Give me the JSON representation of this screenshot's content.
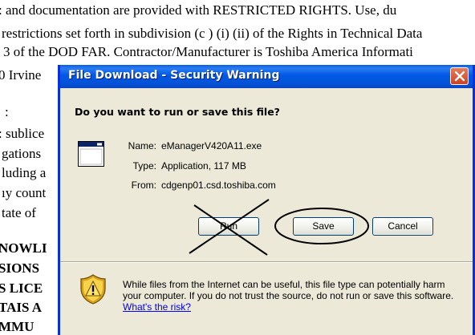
{
  "background_document": {
    "lines": [
      ": and documentation are provided with RESTRICTED RIGHTS. Use, du",
      "restrictions set forth in subdivision (c ) (i) (ii) of the Rights in Technical Data",
      "3 of the DOD FAR. Contractor/Manufacturer is Toshiba America Informati",
      "0 Irvine",
      ":",
      ": sublice",
      "gations",
      "luding a",
      "ıy count",
      "tate of",
      "NOWLI",
      "SIONS",
      "S LICE",
      "TAIS A",
      "MMU"
    ]
  },
  "dialog": {
    "title": "File Download - Security Warning",
    "question": "Do you want to run or save this file?",
    "name_label": "Name:",
    "name_value": "eManagerV420A11.exe",
    "type_label": "Type:",
    "type_value": "Application, 117 MB",
    "from_label": "From:",
    "from_value": "cdgenp01.csd.toshiba.com",
    "run_label": "Run",
    "save_label": "Save",
    "cancel_label": "Cancel",
    "warning_text": "While files from the Internet can be useful, this file type can potentially harm your computer. If you do not trust the source, do not run or save this software.",
    "risk_link": "What's the risk?"
  },
  "icons": {
    "close": "close-icon",
    "app": "application-icon",
    "shield": "security-shield-icon"
  },
  "colors": {
    "titlebar": "#0054e3",
    "dialog_bg": "#ece9d8",
    "close_button": "#d2401e",
    "link": "#0000ee"
  }
}
